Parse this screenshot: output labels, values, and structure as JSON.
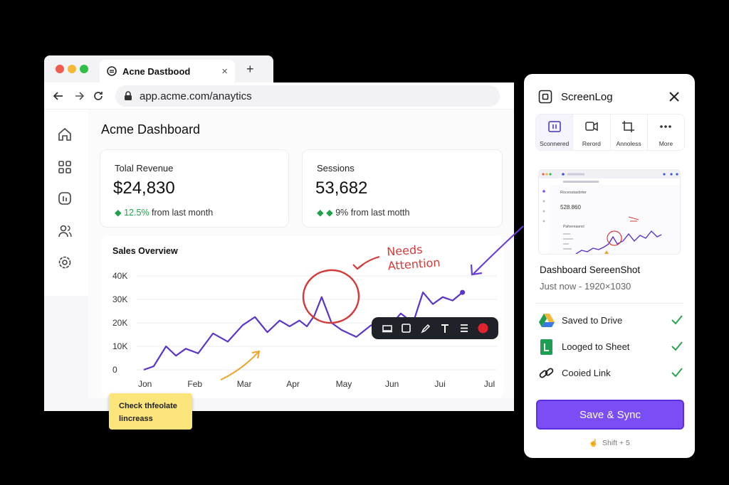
{
  "browser": {
    "tab_title": "Acne Dastbood",
    "new_tab_label": "+",
    "close_tab_label": "×",
    "url": "app.acme.com/anaytics"
  },
  "dashboard": {
    "title": "Acme Dashboard",
    "cards": [
      {
        "label": "Tolal Revenue",
        "value": "$24,830",
        "change_arrow": "◆",
        "change_value": "12.5%",
        "change_text": " from last month"
      },
      {
        "label": "Sessions",
        "value": "53,682",
        "change_arrow": "◆ ◆",
        "change_value": "9%",
        "change_text": " from last motth"
      }
    ]
  },
  "chart_data": {
    "type": "line",
    "title": "Sales Overview",
    "categories": [
      "Jon",
      "Feb",
      "Mar",
      "Apr",
      "May",
      "Jun",
      "Jui",
      "Jul"
    ],
    "y_ticks": [
      "40K",
      "30K",
      "20K",
      "10K",
      "0"
    ],
    "ylim": [
      0,
      40000
    ],
    "series": [
      {
        "x": [
          0,
          0.2,
          0.45,
          0.65,
          0.85,
          1.1,
          1.4,
          1.7,
          2.0,
          2.25,
          2.5,
          2.75,
          2.95,
          3.15,
          3.3,
          3.45,
          3.6,
          3.8,
          4.0,
          4.3,
          4.6,
          4.85,
          5.0,
          5.2,
          5.45,
          5.65,
          5.85,
          6.05,
          6.25,
          6.45
        ],
        "y": [
          0,
          1500,
          10000,
          6000,
          9000,
          7000,
          15500,
          12000,
          19000,
          22500,
          16000,
          21000,
          18500,
          21000,
          18500,
          23000,
          31000,
          20000,
          17000,
          14000,
          19000,
          14500,
          19000,
          24000,
          20000,
          33000,
          28000,
          31000,
          29500,
          33000
        ],
        "color": "#5b34c8"
      }
    ]
  },
  "annotations": {
    "sticky_note": [
      "Check thfeolate",
      "lincreass"
    ],
    "needs_attention": [
      "Needs",
      "Attention"
    ],
    "highlight_color": "#d33b3b",
    "arrow_color": "#6a3fd6",
    "sticky_color": "#fce57a"
  },
  "toolbar": {
    "tools": [
      "rect-select-icon",
      "square-icon",
      "pen-icon",
      "text-icon",
      "menu-icon",
      "record-icon"
    ]
  },
  "panel": {
    "title": "ScreenLog",
    "modes": [
      "Sconnered",
      "Rerord",
      "Annoless",
      "More"
    ],
    "shot_name": "Dashboard SereenShot",
    "shot_meta": "Just now - 1920×1030",
    "thumbnail": {
      "dashboard_title": "Rocesstasbrter",
      "value": "528.860",
      "sub": "Pafoereaanct"
    },
    "statuses": [
      {
        "label": "Saved to Drive",
        "icon": "drive-icon",
        "done": true
      },
      {
        "label": "Looged to Sheet",
        "icon": "sheet-icon",
        "done": true
      },
      {
        "label": "Cooied Link",
        "icon": "link-icon",
        "done": true
      }
    ],
    "save_button": "Save & Sync",
    "shortcut": "Shift + 5",
    "accent": "#7b4df4",
    "check_color": "#2aa352"
  }
}
